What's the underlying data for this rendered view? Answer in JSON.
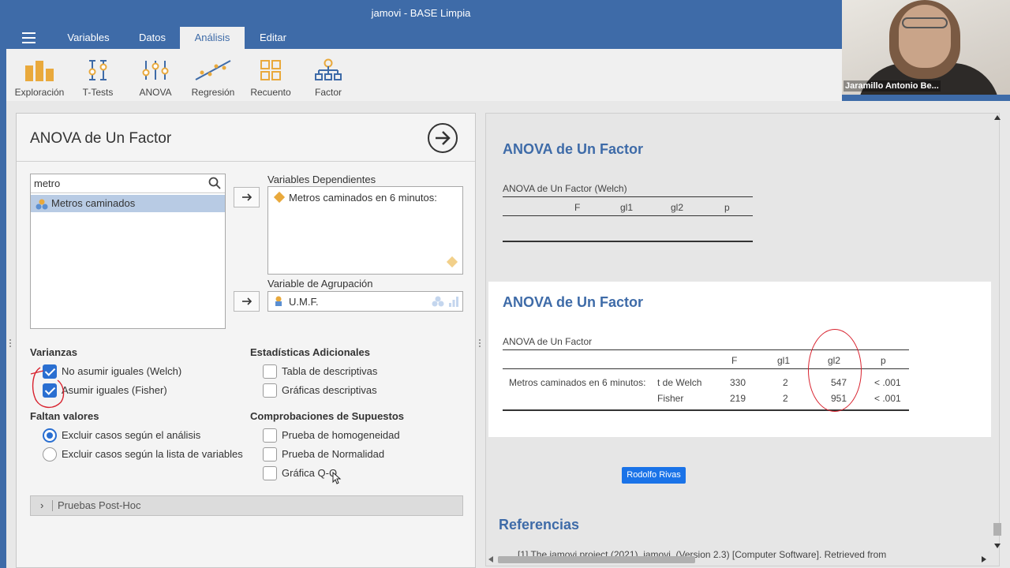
{
  "window": {
    "title": "jamovi - BASE Limpia"
  },
  "tabs": [
    {
      "label": "Variables"
    },
    {
      "label": "Datos"
    },
    {
      "label": "Análisis",
      "active": true
    },
    {
      "label": "Editar"
    }
  ],
  "ribbon": [
    {
      "label": "Exploración",
      "icon": "exploration-icon"
    },
    {
      "label": "T-Tests",
      "icon": "ttest-icon"
    },
    {
      "label": "ANOVA",
      "icon": "anova-icon"
    },
    {
      "label": "Regresión",
      "icon": "regression-icon"
    },
    {
      "label": "Recuento",
      "icon": "frequencies-icon"
    },
    {
      "label": "Factor",
      "icon": "factor-icon"
    }
  ],
  "webcam": {
    "name": "Jaramillo Antonio Be..."
  },
  "options": {
    "title": "ANOVA de Un Factor",
    "search_value": "metro",
    "variables": [
      "Metros caminados"
    ],
    "dependent_label": "Variables Dependientes",
    "dependent_items": [
      "Metros caminados en 6 minutos:"
    ],
    "grouping_label": "Variable de Agrupación",
    "grouping_value": "U.M.F.",
    "varianzas": {
      "heading": "Varianzas",
      "items": [
        {
          "label": "No asumir iguales (Welch)",
          "checked": true
        },
        {
          "label": "Asumir iguales (Fisher)",
          "checked": true
        }
      ]
    },
    "faltan": {
      "heading": "Faltan valores",
      "items": [
        {
          "label": "Excluir casos según el análisis",
          "selected": true
        },
        {
          "label": "Excluir casos según la lista de variables",
          "selected": false
        }
      ]
    },
    "estadisticas": {
      "heading": "Estadísticas Adicionales",
      "items": [
        {
          "label": "Tabla de descriptivas",
          "checked": false
        },
        {
          "label": "Gráficas descriptivas",
          "checked": false
        }
      ]
    },
    "comprobaciones": {
      "heading": "Comprobaciones de Supuestos",
      "items": [
        {
          "label": "Prueba de homogeneidad",
          "checked": false
        },
        {
          "label": "Prueba de Normalidad",
          "checked": false
        },
        {
          "label": "Gráfica Q-Q",
          "checked": false
        }
      ]
    },
    "posthoc": "Pruebas Post-Hoc"
  },
  "results": {
    "block1": {
      "title": "ANOVA de Un Factor",
      "caption": "ANOVA de Un Factor (Welch)",
      "headers": [
        "F",
        "gl1",
        "gl2",
        "p"
      ]
    },
    "block2": {
      "title": "ANOVA de Un Factor",
      "caption": "ANOVA de Un Factor",
      "headers": [
        "F",
        "gl1",
        "gl2",
        "p"
      ],
      "row_label": "Metros caminados en 6 minutos:",
      "rows": [
        {
          "test": "t de Welch",
          "F": "330",
          "gl1": "2",
          "gl2": "547",
          "p": "< .001"
        },
        {
          "test": "Fisher",
          "F": "219",
          "gl1": "2",
          "gl2": "951",
          "p": "< .001"
        }
      ]
    },
    "user_button": "Rodolfo Rivas",
    "references_title": "Referencias",
    "references_text": "[1]  The jamovi project (2021). jamovi. (Version 2.3) [Computer Software]. Retrieved from"
  },
  "colors": {
    "accent": "#3e6ba8",
    "checkbox": "#2a6fd1",
    "annotation": "#d8222e"
  }
}
